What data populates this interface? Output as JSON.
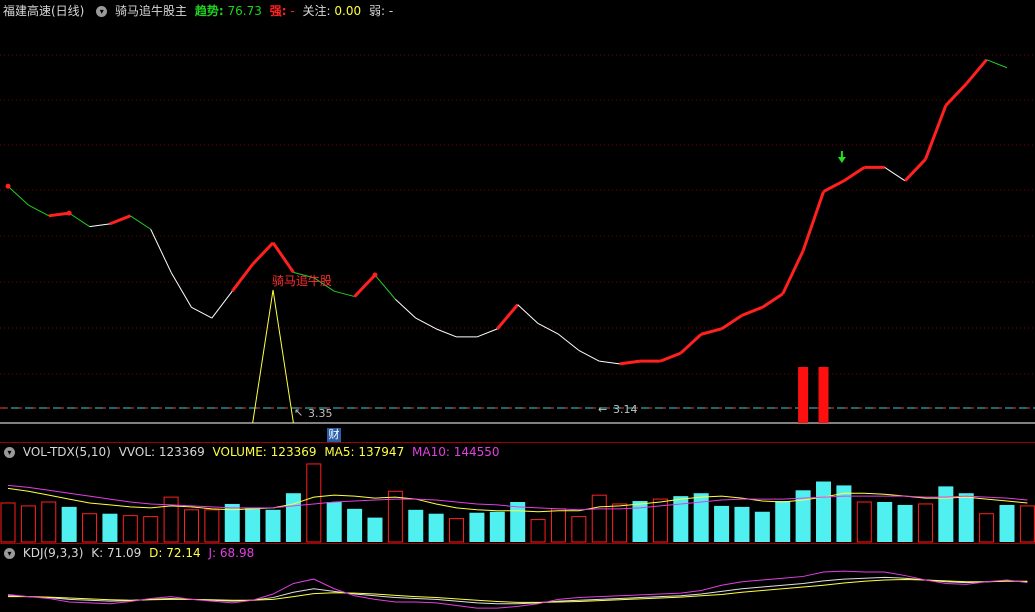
{
  "main_header": {
    "stock_name": "福建高速(日线)",
    "indicator_name": "骑马追牛股主",
    "trend_label": "趋势:",
    "trend_value": "76.73",
    "strong_label": "强:",
    "strong_value": "-",
    "focus_label": "关注:",
    "focus_value": "0.00",
    "weak_label": "弱:",
    "weak_value": "-"
  },
  "main_chart": {
    "signal_label": "骑马追牛股",
    "low_label_1": "3.35",
    "low_label_2": "3.14",
    "finance_badge": "财",
    "colors": {
      "up": "#ff2020",
      "down": "#20d020",
      "flat": "#ffffff",
      "signal": "#ffff40"
    }
  },
  "vol_header": {
    "name": "VOL-TDX(5,10)",
    "vvol_label": "VVOL:",
    "vvol_value": "123369",
    "volume_label": "VOLUME:",
    "volume_value": "123369",
    "ma5_label": "MA5:",
    "ma5_value": "137947",
    "ma10_label": "MA10:",
    "ma10_value": "144550"
  },
  "kdj_header": {
    "name": "KDJ(9,3,3)",
    "k_label": "K:",
    "k_value": "71.09",
    "d_label": "D:",
    "d_value": "72.14",
    "j_label": "J:",
    "j_value": "68.98"
  },
  "chart_data": {
    "type": "line",
    "trend_line": [
      {
        "v": 76.0,
        "c": "up"
      },
      {
        "v": 72.5,
        "c": "down"
      },
      {
        "v": 70.5,
        "c": "down"
      },
      {
        "v": 71.0,
        "c": "up"
      },
      {
        "v": 68.5,
        "c": "down"
      },
      {
        "v": 69.0,
        "c": "flat"
      },
      {
        "v": 70.5,
        "c": "up"
      },
      {
        "v": 68.0,
        "c": "down"
      },
      {
        "v": 60.0,
        "c": "flat"
      },
      {
        "v": 53.5,
        "c": "flat"
      },
      {
        "v": 51.5,
        "c": "flat"
      },
      {
        "v": 56.5,
        "c": "flat"
      },
      {
        "v": 61.5,
        "c": "up"
      },
      {
        "v": 65.5,
        "c": "up"
      },
      {
        "v": 60.0,
        "c": "up"
      },
      {
        "v": 59.0,
        "c": "down"
      },
      {
        "v": 56.5,
        "c": "down"
      },
      {
        "v": 55.5,
        "c": "down"
      },
      {
        "v": 59.5,
        "c": "up"
      },
      {
        "v": 55.0,
        "c": "down"
      },
      {
        "v": 51.5,
        "c": "flat"
      },
      {
        "v": 49.5,
        "c": "flat"
      },
      {
        "v": 48.0,
        "c": "flat"
      },
      {
        "v": 48.0,
        "c": "flat"
      },
      {
        "v": 49.5,
        "c": "flat"
      },
      {
        "v": 54.0,
        "c": "up"
      },
      {
        "v": 50.5,
        "c": "flat"
      },
      {
        "v": 48.5,
        "c": "flat"
      },
      {
        "v": 45.5,
        "c": "flat"
      },
      {
        "v": 43.5,
        "c": "flat"
      },
      {
        "v": 43.0,
        "c": "flat"
      },
      {
        "v": 43.5,
        "c": "up"
      },
      {
        "v": 43.5,
        "c": "up"
      },
      {
        "v": 45.0,
        "c": "up"
      },
      {
        "v": 48.5,
        "c": "up"
      },
      {
        "v": 49.5,
        "c": "up"
      },
      {
        "v": 52.0,
        "c": "up"
      },
      {
        "v": 53.5,
        "c": "up"
      },
      {
        "v": 56.0,
        "c": "up"
      },
      {
        "v": 64.0,
        "c": "up"
      },
      {
        "v": 75.0,
        "c": "up"
      },
      {
        "v": 77.0,
        "c": "up"
      },
      {
        "v": 79.5,
        "c": "up"
      },
      {
        "v": 79.5,
        "c": "up"
      },
      {
        "v": 77.0,
        "c": "flat"
      },
      {
        "v": 81.0,
        "c": "up"
      },
      {
        "v": 91.0,
        "c": "up"
      },
      {
        "v": 95.0,
        "c": "up"
      },
      {
        "v": 99.5,
        "c": "up"
      },
      {
        "v": 98.0,
        "c": "down"
      }
    ],
    "signal_spike_index": 13,
    "red_bar_indices": [
      39,
      40
    ],
    "down_arrow_index": 41,
    "volume_bars": [
      {
        "v": 40000,
        "t": "down"
      },
      {
        "v": 37000,
        "t": "down"
      },
      {
        "v": 41000,
        "t": "down"
      },
      {
        "v": 36000,
        "t": "up"
      },
      {
        "v": 29000,
        "t": "down"
      },
      {
        "v": 29000,
        "t": "up"
      },
      {
        "v": 27000,
        "t": "down"
      },
      {
        "v": 26000,
        "t": "down"
      },
      {
        "v": 46000,
        "t": "down"
      },
      {
        "v": 33000,
        "t": "down"
      },
      {
        "v": 33000,
        "t": "down"
      },
      {
        "v": 39000,
        "t": "up"
      },
      {
        "v": 35000,
        "t": "up"
      },
      {
        "v": 33000,
        "t": "up"
      },
      {
        "v": 50000,
        "t": "up"
      },
      {
        "v": 80000,
        "t": "down"
      },
      {
        "v": 41000,
        "t": "up"
      },
      {
        "v": 34000,
        "t": "up"
      },
      {
        "v": 25000,
        "t": "up"
      },
      {
        "v": 52000,
        "t": "down"
      },
      {
        "v": 33000,
        "t": "up"
      },
      {
        "v": 29000,
        "t": "up"
      },
      {
        "v": 24000,
        "t": "down"
      },
      {
        "v": 30000,
        "t": "up"
      },
      {
        "v": 31000,
        "t": "up"
      },
      {
        "v": 41000,
        "t": "up"
      },
      {
        "v": 23000,
        "t": "down"
      },
      {
        "v": 34000,
        "t": "down"
      },
      {
        "v": 26000,
        "t": "down"
      },
      {
        "v": 48000,
        "t": "down"
      },
      {
        "v": 39000,
        "t": "down"
      },
      {
        "v": 42000,
        "t": "up"
      },
      {
        "v": 44000,
        "t": "down"
      },
      {
        "v": 47000,
        "t": "up"
      },
      {
        "v": 50000,
        "t": "up"
      },
      {
        "v": 37000,
        "t": "up"
      },
      {
        "v": 36000,
        "t": "up"
      },
      {
        "v": 31000,
        "t": "up"
      },
      {
        "v": 42000,
        "t": "up"
      },
      {
        "v": 53000,
        "t": "up"
      },
      {
        "v": 62000,
        "t": "up"
      },
      {
        "v": 58000,
        "t": "up"
      },
      {
        "v": 41000,
        "t": "down"
      },
      {
        "v": 41000,
        "t": "up"
      },
      {
        "v": 38000,
        "t": "up"
      },
      {
        "v": 39000,
        "t": "down"
      },
      {
        "v": 57000,
        "t": "up"
      },
      {
        "v": 50000,
        "t": "up"
      },
      {
        "v": 29000,
        "t": "down"
      },
      {
        "v": 38000,
        "t": "up"
      },
      {
        "v": 37000,
        "t": "down"
      }
    ],
    "ma5": [
      55000,
      52000,
      48000,
      44000,
      40000,
      38000,
      36000,
      35000,
      37000,
      36000,
      34000,
      33000,
      34000,
      35000,
      39000,
      46000,
      48000,
      47000,
      45000,
      46000,
      44000,
      39000,
      35000,
      33000,
      32000,
      32000,
      31000,
      32000,
      32000,
      36000,
      37000,
      39000,
      41000,
      44000,
      46000,
      47000,
      45000,
      42000,
      41000,
      43000,
      46000,
      50000,
      50000,
      49000,
      47000,
      45000,
      45000,
      46000,
      44000,
      42000,
      40000
    ],
    "ma10": [
      58000,
      56000,
      53000,
      50000,
      47000,
      44000,
      41000,
      39000,
      38000,
      37000,
      36000,
      35000,
      35000,
      35000,
      37000,
      39000,
      41000,
      42000,
      43000,
      44000,
      44000,
      43000,
      41000,
      39000,
      38000,
      36000,
      35000,
      34000,
      33000,
      34000,
      34000,
      35000,
      37000,
      39000,
      41000,
      43000,
      44000,
      44000,
      44000,
      45000,
      46000,
      47000,
      47000,
      47000,
      47000,
      46000,
      46000,
      47000,
      46000,
      45000,
      43000
    ],
    "vol_max": 82000,
    "kdj_k": [
      30,
      28,
      26,
      22,
      20,
      18,
      19,
      22,
      24,
      22,
      20,
      18,
      20,
      26,
      38,
      46,
      40,
      34,
      30,
      26,
      24,
      22,
      18,
      14,
      12,
      12,
      14,
      18,
      20,
      22,
      24,
      26,
      28,
      30,
      34,
      40,
      46,
      50,
      54,
      58,
      64,
      68,
      70,
      72,
      70,
      66,
      62,
      60,
      62,
      64,
      62
    ],
    "kdj_d": [
      28,
      28,
      27,
      25,
      23,
      21,
      20,
      21,
      22,
      22,
      21,
      20,
      20,
      22,
      28,
      35,
      37,
      36,
      34,
      31,
      28,
      26,
      23,
      20,
      17,
      15,
      15,
      16,
      17,
      19,
      21,
      23,
      25,
      27,
      30,
      33,
      38,
      42,
      46,
      50,
      54,
      59,
      63,
      66,
      67,
      66,
      64,
      62,
      62,
      63,
      63
    ],
    "kdj_j": [
      33,
      28,
      24,
      16,
      14,
      12,
      17,
      24,
      28,
      22,
      18,
      14,
      20,
      34,
      58,
      68,
      46,
      30,
      22,
      16,
      16,
      14,
      8,
      2,
      2,
      6,
      12,
      22,
      26,
      28,
      30,
      32,
      34,
      36,
      42,
      54,
      62,
      66,
      70,
      74,
      84,
      86,
      84,
      84,
      76,
      66,
      58,
      56,
      62,
      66,
      60
    ],
    "kdj_range": [
      0,
      100
    ]
  }
}
